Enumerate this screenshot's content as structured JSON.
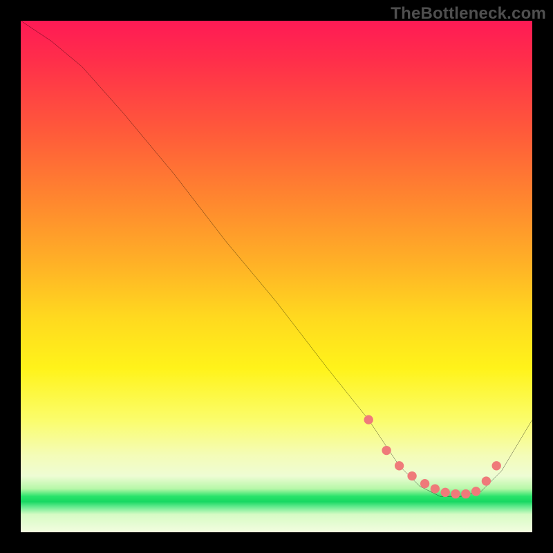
{
  "watermark": "TheBottleneck.com",
  "chart_data": {
    "type": "line",
    "title": "",
    "xlabel": "",
    "ylabel": "",
    "xlim": [
      0,
      100
    ],
    "ylim": [
      0,
      100
    ],
    "series": [
      {
        "name": "curve",
        "x": [
          0,
          6,
          12,
          20,
          30,
          40,
          50,
          60,
          68,
          74,
          78,
          82,
          86,
          90,
          94,
          100
        ],
        "y": [
          100,
          96,
          91,
          82,
          70,
          57,
          45,
          32,
          22,
          13,
          9,
          7,
          7,
          8,
          12,
          22
        ]
      }
    ],
    "markers": {
      "name": "dots",
      "x": [
        68,
        71.5,
        74,
        76.5,
        79,
        81,
        83,
        85,
        87,
        89,
        91,
        93
      ],
      "y": [
        22,
        16,
        13,
        11,
        9.5,
        8.5,
        7.8,
        7.5,
        7.5,
        8,
        10,
        13
      ]
    },
    "colors": {
      "curve": "#000000",
      "marker": "#ef7a7a"
    }
  }
}
